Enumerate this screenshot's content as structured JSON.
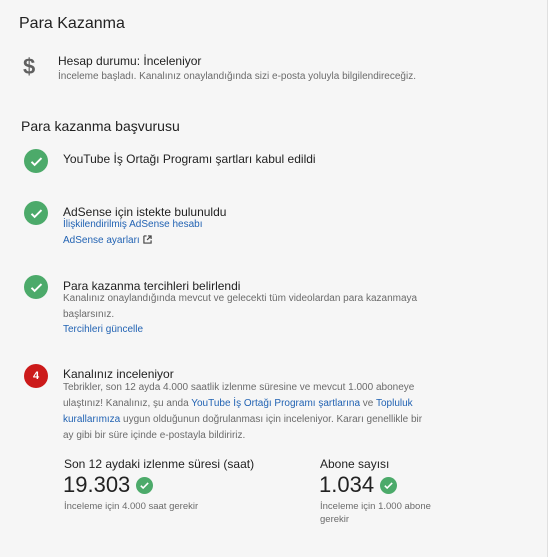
{
  "monetization": {
    "title": "Para Kazanma",
    "status": {
      "icon": "dollar-icon",
      "title": "Hesap durumu: İnceleniyor",
      "subtitle": "İnceleme başladı. Kanalınız onaylandığında sizi e-posta yoluyla bilgilendireceğiz."
    },
    "application_title": "Para kazanma başvurusu",
    "steps": [
      {
        "icon": "check-icon",
        "title": "YouTube İş Ortağı Programı şartları kabul edildi"
      },
      {
        "icon": "check-icon",
        "title": "AdSense için istekte bulunuldu",
        "link1": "İlişkilendirilmiş AdSense hesabı",
        "link2": "AdSense ayarları"
      },
      {
        "icon": "check-icon",
        "title": "Para kazanma tercihleri belirlendi",
        "text_line1": "Kanalınız onaylandığında mevcut ve gelecekti tüm videolardan para kazanmaya",
        "text_line2": "başlarsınız.",
        "link": "Tercihleri güncelle"
      },
      {
        "number": "4",
        "title": "Kanalınız inceleniyor",
        "line1": "Tebrikler, son 12 ayda 4.000 saatlik izlenme süresine ve mevcut 1.000 aboneye",
        "line2_a": "ulaştınız! Kanalınız, şu anda ",
        "line2_link1": "YouTube İş Ortağı Programı şartlarına",
        "line2_b": " ve ",
        "line2_link2": "Topluluk",
        "line3_link": "kurallarımıza",
        "line3_b": " uygun olduğunun doğrulanması için inceleniyor. Kararı genellikle bir",
        "line4": "ay gibi bir süre içinde e-postayla bildiririz."
      }
    ],
    "metrics": [
      {
        "label": "Son 12 aydaki izlenme süresi (saat)",
        "value": "19.303",
        "note": "İnceleme için 4.000 saat gerekir"
      },
      {
        "label": "Abone sayısı",
        "value": "1.034",
        "note_line1": "İnceleme için 1.000 abone",
        "note_line2": "gerekir"
      }
    ]
  },
  "colors": {
    "success": "#4caa6a",
    "step_pending": "#cc1a1a",
    "link": "#2263b3"
  }
}
